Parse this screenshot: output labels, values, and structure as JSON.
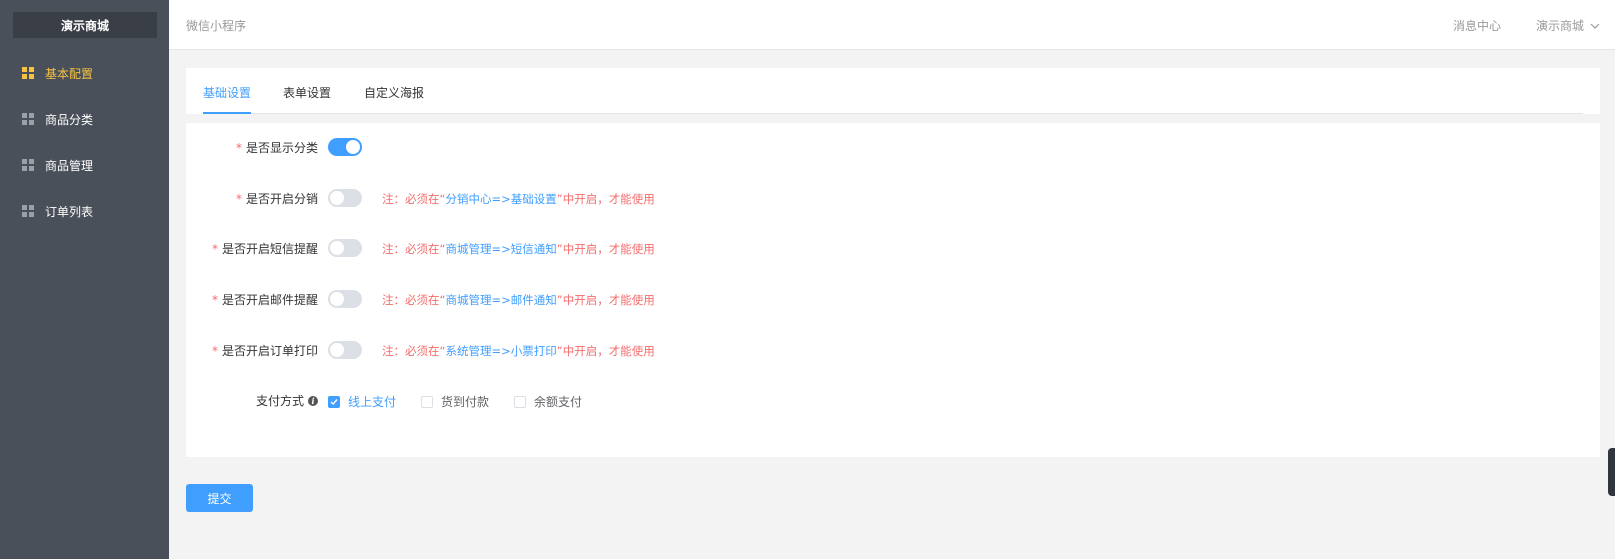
{
  "sidebar": {
    "brand": "演示商城",
    "items": [
      {
        "label": "基本配置",
        "active": true
      },
      {
        "label": "商品分类",
        "active": false
      },
      {
        "label": "商品管理",
        "active": false
      },
      {
        "label": "订单列表",
        "active": false
      }
    ]
  },
  "header": {
    "breadcrumb": "微信小程序",
    "messages": "消息中心",
    "user": "演示商城"
  },
  "tabs": [
    {
      "label": "基础设置",
      "active": true
    },
    {
      "label": "表单设置",
      "active": false
    },
    {
      "label": "自定义海报",
      "active": false
    }
  ],
  "form": {
    "rows": [
      {
        "label": "是否显示分类",
        "required": true,
        "on": true
      },
      {
        "label": "是否开启分销",
        "required": true,
        "on": false,
        "note_prefix": "注：必须在“",
        "note_link": "分销中心=>基础设置",
        "note_suffix": "”中开启，才能使用"
      },
      {
        "label": "是否开启短信提醒",
        "required": true,
        "on": false,
        "note_prefix": "注：必须在“",
        "note_link": "商城管理=>短信通知",
        "note_suffix": "”中开启，才能使用"
      },
      {
        "label": "是否开启邮件提醒",
        "required": true,
        "on": false,
        "note_prefix": "注：必须在“",
        "note_link": "商城管理=>邮件通知",
        "note_suffix": "”中开启，才能使用"
      },
      {
        "label": "是否开启订单打印",
        "required": true,
        "on": false,
        "note_prefix": "注：必须在“",
        "note_link": "系统管理=>小票打印",
        "note_suffix": "”中开启，才能使用"
      }
    ],
    "payment": {
      "label": "支付方式",
      "options": [
        {
          "label": "线上支付",
          "checked": true
        },
        {
          "label": "货到付款",
          "checked": false
        },
        {
          "label": "余额支付",
          "checked": false
        }
      ]
    },
    "required_mark": "*"
  },
  "submit_label": "提交",
  "colors": {
    "primary": "#409eff",
    "danger": "#f56c6c",
    "sidebar_bg": "#4a5059",
    "active_menu": "#f5c242"
  }
}
